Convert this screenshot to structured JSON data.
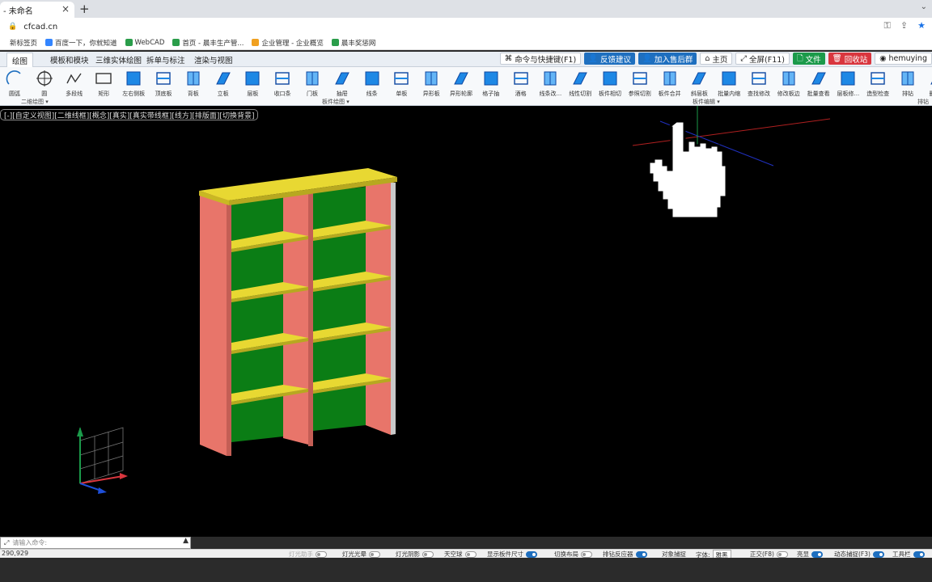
{
  "browser": {
    "tab_title": "- 未命名",
    "tab_close": "×",
    "new_tab": "+",
    "url": "cfcad.cn",
    "bookmarks": [
      {
        "label": "新标签页",
        "color": "#ffffff"
      },
      {
        "label": "百度一下，你就知道",
        "color": "#3385ff"
      },
      {
        "label": "WebCAD",
        "color": "#2a9d4a"
      },
      {
        "label": "首页 - 晨丰生产管...",
        "color": "#2a9d4a"
      },
      {
        "label": "企业管理 - 企业概览",
        "color": "#f0a020"
      },
      {
        "label": "晨丰奖惩网",
        "color": "#2a9d4a"
      }
    ]
  },
  "menu": {
    "tabs": [
      "绘图",
      "模板和模块",
      "三维实体绘图",
      "拆单与标注",
      "渲染与视图"
    ],
    "active_tab": "绘图",
    "buttons": [
      {
        "label": "命令与快捷键(F1)",
        "style": "plain",
        "icon": "⌘"
      },
      {
        "label": "反馈建议",
        "style": "blue",
        "icon": "👤"
      },
      {
        "label": "加入售后群",
        "style": "blue",
        "icon": "👤"
      },
      {
        "label": "主页",
        "style": "plain",
        "icon": "⌂"
      },
      {
        "label": "全屏(F11)",
        "style": "plain",
        "icon": "⤢"
      },
      {
        "label": "文件",
        "style": "green",
        "icon": "🗋"
      },
      {
        "label": "回收站",
        "style": "red",
        "icon": "🗑"
      },
      {
        "label": "hemuying",
        "style": "plain",
        "icon": "◉"
      }
    ]
  },
  "ribbon": {
    "tools": [
      {
        "label": "圆弧",
        "icon": "arc-icon"
      },
      {
        "label": "圆",
        "icon": "circle-icon"
      },
      {
        "label": "多段线",
        "icon": "polyline-icon"
      },
      {
        "label": "矩形",
        "icon": "rectangle-icon"
      },
      {
        "label": "左右侧板",
        "icon": "side-panel-icon"
      },
      {
        "label": "顶底板",
        "icon": "top-bottom-panel-icon"
      },
      {
        "label": "背板",
        "icon": "back-panel-icon"
      },
      {
        "label": "立板",
        "icon": "vertical-panel-icon"
      },
      {
        "label": "层板",
        "icon": "shelf-panel-icon"
      },
      {
        "label": "收口条",
        "icon": "trim-strip-icon"
      },
      {
        "label": "门板",
        "icon": "door-panel-icon"
      },
      {
        "label": "抽屉",
        "icon": "drawer-icon"
      },
      {
        "label": "线条",
        "icon": "line-strip-icon"
      },
      {
        "label": "单板",
        "icon": "single-panel-icon"
      },
      {
        "label": "异形板",
        "icon": "shaped-panel-icon"
      },
      {
        "label": "异形轮廓",
        "icon": "shaped-outline-icon"
      },
      {
        "label": "格子抽",
        "icon": "grid-drawer-icon"
      },
      {
        "label": "酒格",
        "icon": "wine-rack-icon"
      },
      {
        "label": "线条改...",
        "icon": "edit-line-icon"
      },
      {
        "label": "线性切割",
        "icon": "linear-cut-icon"
      },
      {
        "label": "板件相切",
        "icon": "panel-tangent-icon"
      },
      {
        "label": "参照切割",
        "icon": "reference-cut-icon"
      },
      {
        "label": "板件合并",
        "icon": "panel-merge-icon"
      },
      {
        "label": "斜层板",
        "icon": "slant-shelf-icon"
      },
      {
        "label": "批量内缩",
        "icon": "batch-inset-icon"
      },
      {
        "label": "查找修改",
        "icon": "find-edit-icon"
      },
      {
        "label": "修改板边",
        "icon": "edit-edge-icon"
      },
      {
        "label": "批量查看",
        "icon": "batch-view-icon"
      },
      {
        "label": "层板修...",
        "icon": "shelf-edit-icon"
      },
      {
        "label": "造型检查",
        "icon": "shape-check-icon"
      },
      {
        "label": "排钻",
        "icon": "drill-icon"
      },
      {
        "label": "删除...",
        "icon": "delete-drill-icon"
      }
    ],
    "groups": [
      "二维绘图",
      "板件绘图",
      "板件编辑",
      "排钻"
    ]
  },
  "viewport": {
    "view_controls": "[-][自定义视图][二维线框][概念][真实][真实带线框][线方][排版面][切换背景]"
  },
  "command": {
    "placeholder": "请输入命令:",
    "coords": "290,929"
  },
  "status": {
    "items": [
      {
        "label": "灯光助手",
        "on": false,
        "dim": true
      },
      {
        "label": "灯光光晕",
        "on": false,
        "dim": false
      },
      {
        "label": "灯光阴影",
        "on": false,
        "dim": false
      },
      {
        "label": "天空球",
        "on": false,
        "dim": false
      },
      {
        "label": "显示板件尺寸",
        "on": true,
        "dim": false
      },
      {
        "label": "切换布局",
        "on": false,
        "dim": false
      },
      {
        "label": "排钻反应器",
        "on": true,
        "dim": false
      },
      {
        "label": "对象捕捉",
        "on": null,
        "dim": false
      },
      {
        "label": "字体:",
        "on": null,
        "dim": false
      },
      {
        "label": "正交(F8)",
        "on": false,
        "dim": false
      },
      {
        "label": "亮显",
        "on": true,
        "dim": false
      },
      {
        "label": "动态捕捉(F3)",
        "on": true,
        "dim": false
      },
      {
        "label": "工具栏",
        "on": true,
        "dim": false
      }
    ],
    "font_value": "雅黑"
  },
  "colors": {
    "side_panel": "#e8756a",
    "shelf": "#e8d832",
    "back": "#0b7d15",
    "accent_blue": "#1e6fbf"
  }
}
